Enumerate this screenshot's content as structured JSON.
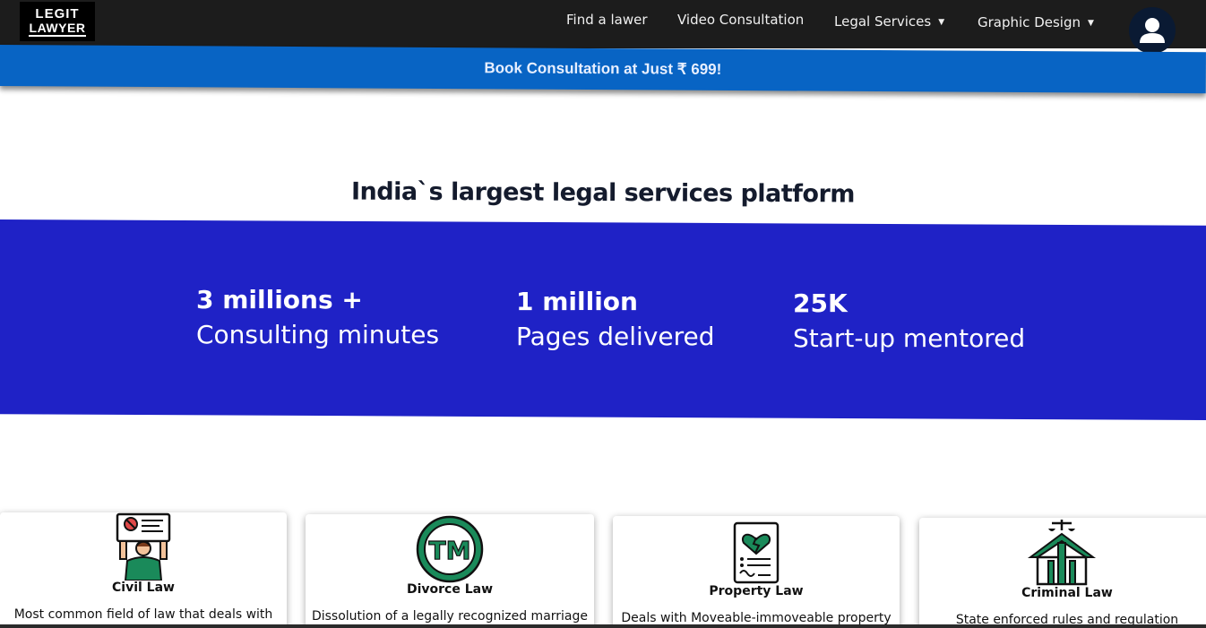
{
  "nav": {
    "logo_line1": "LEGIT",
    "logo_line2": "LAWYER",
    "items": [
      {
        "label": "Find a lawer"
      },
      {
        "label": "Video Consultation"
      },
      {
        "label": "Legal Services",
        "has_dropdown": true
      },
      {
        "label": "Graphic Design",
        "has_dropdown": true
      }
    ],
    "avatar_icon": "user-icon"
  },
  "promo": {
    "text": "Book Consultation at Just ₹ 699!"
  },
  "headline": "India`s largest legal services platform",
  "stats": [
    {
      "value": "3 millions +",
      "label": "Consulting minutes"
    },
    {
      "value": "1 million",
      "label": "Pages delivered"
    },
    {
      "value": "25K",
      "label": "Start-up mentored"
    }
  ],
  "cards": [
    {
      "title": "Civil Law",
      "desc": "Most common field of law that deals with",
      "icon": "protest-sign-icon"
    },
    {
      "title": "Divorce Law",
      "desc": "Dissolution of a legally recognized marriage",
      "icon": "trademark-icon"
    },
    {
      "title": "Property Law",
      "desc": "Deals with Moveable-immoveable property",
      "icon": "broken-heart-document-icon"
    },
    {
      "title": "Criminal Law",
      "desc": "State enforced rules and regulation",
      "icon": "courthouse-scales-icon"
    }
  ],
  "colors": {
    "nav_bg": "#1c1c1c",
    "promo_bg": "#0864c4",
    "stats_bg": "#1f22c6",
    "icon_green": "#1a8a5a"
  }
}
